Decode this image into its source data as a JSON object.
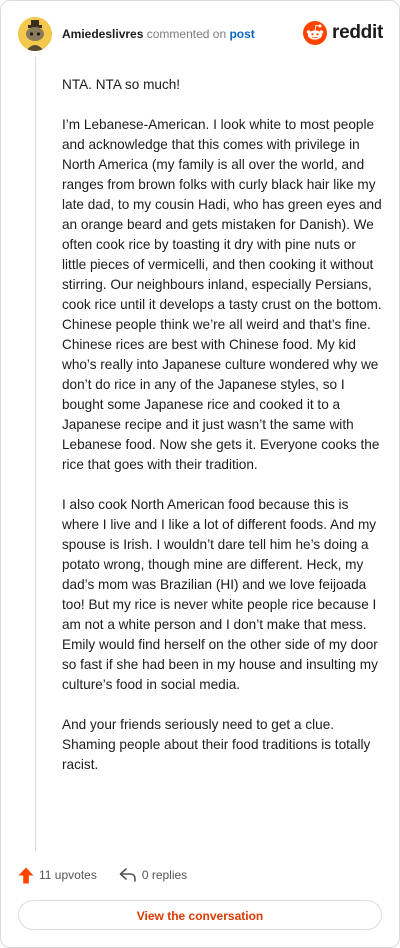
{
  "header": {
    "username": "Amiedeslivres",
    "action": "commented on",
    "post_link": "post",
    "brand": "reddit"
  },
  "comment": {
    "paragraphs": [
      "NTA. NTA so much!",
      "I’m Lebanese-American. I look white to most people and acknowledge that this comes with privilege in North America (my family is all over the world, and ranges from brown folks with curly black hair like my late dad, to my cousin Hadi, who has green eyes and an orange beard and gets mistaken for Danish). We often cook rice by toasting it dry with pine nuts or little pieces of vermicelli, and then cooking it without stirring. Our neighbours inland, especially Persians, cook rice until it develops a tasty crust on the bottom. Chinese people think we’re all weird and that’s fine. Chinese rices are best with Chinese food. My kid who’s really into Japanese culture wondered why we don’t do rice in any of the Japanese styles, so I bought some Japanese rice and cooked it to a Japanese recipe and it just wasn’t the same with Lebanese food. Now she gets it. Everyone cooks the rice that goes with their tradition.",
      "I also cook North American food because this is where I live and I like a lot of different foods. And my spouse is Irish. I wouldn’t dare tell him he’s doing a potato wrong, though mine are different. Heck, my dad’s mom was Brazilian (HI) and we love feijoada too! But my rice is never white people rice because I am not a white person and I don’t make that mess. Emily would find herself on the other side of my door so fast if she had been in my house and insulting my culture’s food in social media.",
      "And your friends seriously need to get a clue. Shaming people about their food traditions is totally racist."
    ]
  },
  "footer": {
    "upvotes": "11 upvotes",
    "replies": "0 replies",
    "view_button": "View the conversation"
  },
  "colors": {
    "brand": "#ff4500",
    "upvote": "#ff4500",
    "link": "#0a66c2",
    "button_text": "#d93a00",
    "avatar": "#f2c94c"
  },
  "icons": {
    "avatar": "snoo-avatar-icon",
    "brand": "reddit-logo-icon",
    "upvote": "upvote-arrow-icon",
    "replies": "reply-arrow-icon"
  }
}
